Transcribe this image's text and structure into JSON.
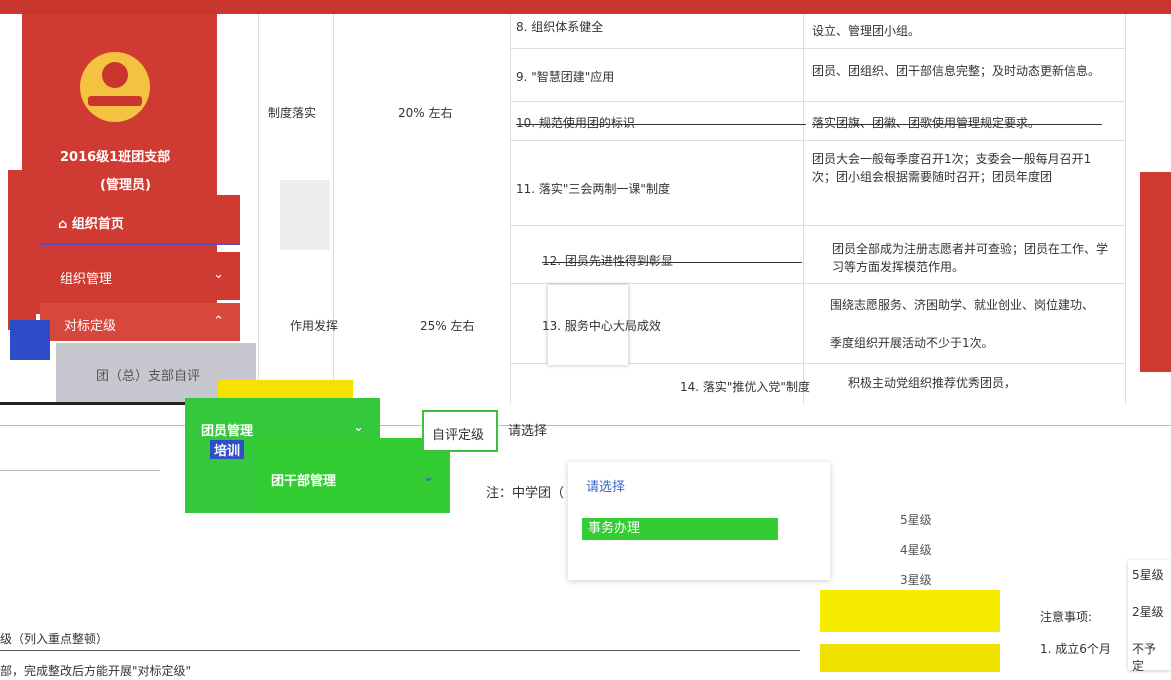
{
  "header": {
    "brand_color": "#c8362e"
  },
  "sidebar": {
    "org_name": "2016级1班团支部",
    "role": "(管理员)",
    "nav": {
      "home": "组织首页",
      "org_manage": "组织管理",
      "standard": "对标定级",
      "self_eval": "团（总）支部自评"
    }
  },
  "table": {
    "rows": [
      {
        "item": "8. 组织体系健全",
        "desc": "设立、管理团小组。"
      },
      {
        "item": "9. \"智慧团建\"应用",
        "desc": "团员、团组织、团干部信息完整；及时动态更新信息。"
      },
      {
        "item": "10. 规范使用团的标识",
        "desc": "落实团旗、团徽、团歌使用管理规定要求。"
      },
      {
        "item": "11. 落实\"三会两制一课\"制度",
        "desc": "团员大会一般每季度召开1次；支委会一般每月召开1次；团小组会根据需要随时召开；团员年度团"
      },
      {
        "item": "12. 团员先进性得到彰显",
        "desc": "团员全部成为注册志愿者并可查验；团员在工作、学习等方面发挥模范作用。"
      },
      {
        "item": "13. 服务中心大局成效",
        "desc": "围绕志愿服务、济困助学、就业创业、岗位建功、"
      },
      {
        "item": "14. 落实\"推优入党\"制度",
        "desc": "积极主动党组织推荐优秀团员，"
      }
    ],
    "category1": "制度落实",
    "weight1": "20% 左右",
    "category2": "作用发挥",
    "weight2": "25% 左右",
    "extra_desc": "季度组织开展活动不少于1次。"
  },
  "overlays": {
    "member_manage": "团员管理",
    "cadre_manage": "团干部管理",
    "training": "培训",
    "self_grade_tab": "自评定级",
    "select_placeholder": "请选择",
    "note": "注：中学团（",
    "dropdown_title": "请选择",
    "dropdown_item": "事务办理",
    "stars": [
      "5星级",
      "4星级",
      "3星级"
    ],
    "notice_title": "注意事项:",
    "notice_item": "1. 成立6个月",
    "right_options": [
      "5星级",
      "2星级",
      "不予定"
    ],
    "bottom_line1": "级（列入重点整顿）",
    "bottom_line2": "部，完成整改后方能开展\"对标定级\""
  }
}
